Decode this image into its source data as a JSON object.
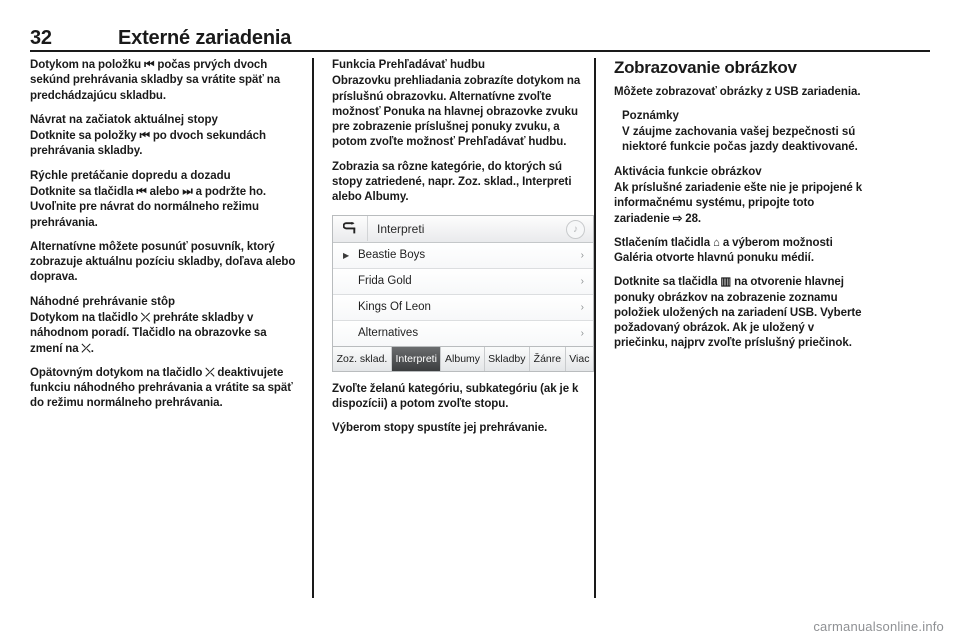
{
  "header": {
    "page_number": "32",
    "chapter_title": "Externé zariadenia"
  },
  "columns": {
    "left": {
      "paragraphs": [
        "Dotykom na položku ⏮ počas prvých dvoch sekúnd prehrávania skladby sa vrátite späť na predchádzajúcu skladbu."
      ],
      "blocks": [
        {
          "heading": "Návrat na začiatok aktuálnej stopy",
          "body": "Dotknite sa položky ⏮ po dvoch sekundách prehrávania skladby."
        },
        {
          "heading": "Rýchle pretáčanie dopredu a dozadu",
          "body": "Dotknite sa tlačidla ⏮ alebo ⏭ a podržte ho. Uvoľnite pre návrat do normálneho režimu prehrávania."
        }
      ],
      "paragraph_alt": "Alternatívne môžete posunúť posuvník, ktorý zobrazuje aktuálnu pozíciu skladby, doľava alebo doprava.",
      "shuffle": {
        "heading": "Náhodné prehrávanie stôp",
        "body": "Dotykom na tlačidlo ⤫ prehráte skladby v náhodnom poradí. Tlačidlo na obrazovke sa zmení na ⤫.",
        "body2": "Opätovným dotykom na tlačidlo ⤫ deaktivujete funkciu náhodného prehrávania a vrátite sa späť do režimu normálneho prehrávania."
      }
    },
    "middle": {
      "browse": {
        "heading": "Funkcia Prehľadávať hudbu",
        "body1": "Obrazovku prehliadania zobrazíte dotykom na príslušnú obrazovku. Alternatívne zvoľte možnosť Ponuka na hlavnej obrazovke zvuku pre zobrazenie príslušnej ponuky zvuku, a potom zvoľte možnosť Prehľadávať hudbu.",
        "body2": "Zobrazia sa rôzne kategórie, do ktorých sú stopy zatriedené, napr. Zoz. sklad., Interpreti alebo Albumy."
      },
      "screenshot": {
        "back_icon": "back-arrow-icon",
        "title": "Interpreti",
        "corner_icon": "music-note-icon",
        "rows": [
          {
            "label": "Beastie Boys",
            "playing": true
          },
          {
            "label": "Frida Gold",
            "playing": false
          },
          {
            "label": "Kings Of Leon",
            "playing": false
          },
          {
            "label": "Alternatives",
            "playing": false
          }
        ],
        "tabs": [
          {
            "label": "Zoz. sklad.",
            "active": false
          },
          {
            "label": "Interpreti",
            "active": true
          },
          {
            "label": "Albumy",
            "active": false
          },
          {
            "label": "Skladby",
            "active": false
          },
          {
            "label": "Žánre",
            "active": false
          },
          {
            "label": "Viac",
            "active": false
          }
        ]
      },
      "after_shot": {
        "body1": "Zvoľte želanú kategóriu, subkategóriu (ak je k dispozícii) a potom zvoľte stopu.",
        "body2": "Výberom stopy spustíte jej prehrávanie."
      }
    },
    "right": {
      "section_title": "Zobrazovanie obrázkov",
      "intro": "Môžete zobrazovať obrázky z USB zariadenia.",
      "note": {
        "heading": "Poznámky",
        "body": "V záujme zachovania vašej bezpečnosti sú niektoré funkcie počas jazdy deaktivované."
      },
      "activate": {
        "heading": "Aktivácia funkcie obrázkov",
        "body1": "Ak príslušné zariadenie ešte nie je pripojené k informačnému systému, pripojte toto zariadenie ⇨ 28.",
        "body2": "Stlačením tlačidla ⌂ a výberom možnosti Galéria otvorte hlavnú ponuku médií.",
        "body3": "Dotknite sa tlačidla ▥ na otvorenie hlavnej ponuky obrázkov na zobrazenie zoznamu položiek uložených na zariadení USB. Vyberte požadovaný obrázok. Ak je uložený v priečinku, najprv zvoľte príslušný priečinok."
      }
    }
  },
  "watermark": "carmanualsonline.info"
}
